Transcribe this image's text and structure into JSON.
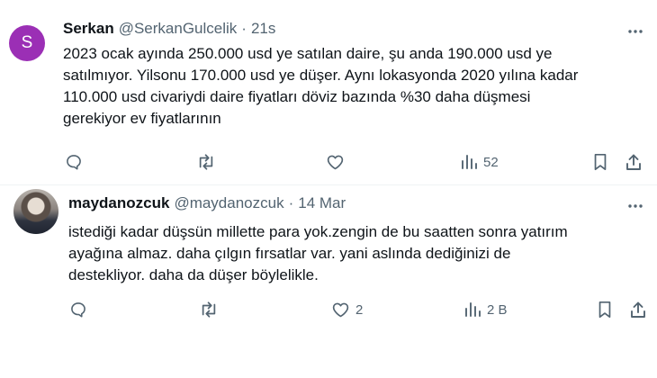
{
  "tweets": [
    {
      "avatar_letter": "S",
      "display_name": "Serkan",
      "handle": "@SerkanGulcelik",
      "separator": "·",
      "time": "21s",
      "text": "2023 ocak ayında 250.000 usd ye satılan daire, şu anda 190.000 usd ye\nsatılmıyor. Yilsonu 170.000 usd ye düşer. Aynı lokasyonda 2020 yılına kadar\n110.000 usd civariydi daire fiyatları döviz bazında %30 daha düşmesi\ngerekiyor ev fiyatlarının",
      "views": "52",
      "likes": ""
    },
    {
      "display_name": "maydanozcuk",
      "handle": "@maydanozcuk",
      "separator": "·",
      "time": "14 Mar",
      "text": "istediği kadar düşsün millette para yok.zengin de bu saatten sonra yatırım\nayağına almaz. daha çılgın fırsatlar var. yani aslında dediğinizi de\ndestekliyor. daha da düşer böylelikle.",
      "likes": "2",
      "views": "2 B"
    }
  ],
  "icons": {
    "reply": "reply-icon",
    "retweet": "retweet-icon",
    "like": "heart-icon",
    "views": "views-icon",
    "bookmark": "bookmark-icon",
    "share": "share-icon",
    "more": "more-icon"
  },
  "colors": {
    "avatar_bg": "#9b2fb5",
    "text": "#0f1419",
    "muted": "#536471",
    "divider": "#eff3f4"
  }
}
